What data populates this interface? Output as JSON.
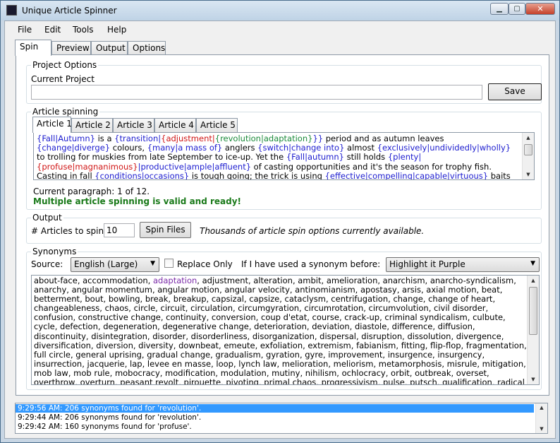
{
  "window": {
    "title": "Unique Article Spinner",
    "min_glyph": "▁",
    "max_glyph": "▢",
    "close_glyph": "✕"
  },
  "menu": [
    "File",
    "Edit",
    "Tools",
    "Help"
  ],
  "tabs": [
    "Spin",
    "Preview",
    "Output",
    "Options"
  ],
  "project": {
    "legend": "Project Options",
    "current_label": "Current Project",
    "current_value": "",
    "save_label": "Save"
  },
  "spinning": {
    "legend": "Article spinning",
    "article_tabs": [
      "Article 1",
      "Article 2",
      "Article 3",
      "Article 4",
      "Article 5"
    ],
    "text_lines": [
      [
        [
          "{Fall|Autumn}",
          "blue"
        ],
        [
          " is a ",
          ""
        ],
        [
          "{transition|",
          "blue"
        ],
        [
          "{adjustment|",
          "red"
        ],
        [
          "{revolution|adaptation}",
          "green"
        ],
        [
          "}}",
          "blue"
        ],
        [
          " period and as autumn leaves",
          ""
        ]
      ],
      [
        [
          "{change|diverge}",
          "blue"
        ],
        [
          " colours, ",
          ""
        ],
        [
          "{many|a mass of}",
          "blue"
        ],
        [
          " anglers ",
          ""
        ],
        [
          "{switch|change into}",
          "blue"
        ],
        [
          " almost ",
          ""
        ],
        [
          "{exclusively|undividedly|wholly}",
          "blue"
        ]
      ],
      [
        [
          "to trolling for muskies from late September to ice-up. Yet the ",
          ""
        ],
        [
          "{Fall|autumn}",
          "blue"
        ],
        [
          " still holds ",
          ""
        ],
        [
          "{plenty|",
          "blue"
        ]
      ],
      [
        [
          "{profuse|magnanimous}",
          "red"
        ],
        [
          "|productive|ample|affluent}",
          "blue"
        ],
        [
          " of casting opportunities and it's the season for trophy fish.",
          ""
        ]
      ],
      [
        [
          "Casting in fall ",
          ""
        ],
        [
          "{conditions|occasions}",
          "blue"
        ],
        [
          " is tough going; the trick is using ",
          ""
        ],
        [
          "{effective|compelling|capable|virtuous}",
          "blue"
        ],
        [
          " baits",
          ""
        ]
      ]
    ],
    "paragraph_status": "Current paragraph: 1 of 12.",
    "valid_message": "Multiple article spinning is valid and ready!"
  },
  "output": {
    "legend": "Output",
    "articles_label": "# Articles to spin:",
    "articles_value": "10",
    "spin_button": "Spin Files",
    "info": "Thousands of article spin options currently available."
  },
  "synonyms": {
    "legend": "Synonyms",
    "source_label": "Source:",
    "source_value": "English (Large)",
    "replace_only_label": "Replace Only",
    "replace_only_checked": false,
    "used_before_label": "If I have used a synonym before:",
    "used_before_value": "Highlight it Purple",
    "highlighted_word": "adaptation",
    "list_before": "about-face, accommodation, ",
    "list_after": ", adjustment, alteration, ambit, amelioration, anarchism, anarcho-syndicalism, anarchy, angular momentum, angular motion, angular velocity, antinomianism, apostasy, arsis, axial motion, beat, betterment, bout, bowling, break, breakup, capsizal, capsize, cataclysm, centrifugation, change, change of heart, changeableness, chaos, circle, circuit, circulation, circumgyration, circumrotation, circumvolution, civil disorder, confusion, constructive change, continuity, conversion, coup d'etat, course, crack-up, criminal syndicalism, culbute, cycle, defection, degeneration, degenerative change, deterioration, deviation, diastole, difference, diffusion, discontinuity, disintegration, disorder, disorderliness, disorganization, dispersal, disruption, dissolution, divergence, diversification, diversion, diversity, downbeat, emeute, exfoliation, extremism, fabianism, fitting, flip-flop, fragmentation, full circle, general uprising, gradual change, gradualism, gyration, gyre, improvement, insurgence, insurgency, insurrection, jacquerie, lap, levee en masse, loop, lynch law, melioration, meliorism, metamorphosis, misrule, mitigation, mob law, mob rule, mobocracy, modification, modulation, mutiny, nihilism, ochlocracy, orbit, outbreak, overset, overthrow, overturn, peasant revolt, pirouette, pivoting, primal chaos, progressivism, pulse, putsch, qualification, radical"
  },
  "log": [
    "9:29:56 AM: 206 synonyms found for 'revolution'.",
    "9:29:44 AM: 206 synonyms found for 'revolution'.",
    "9:29:42 AM: 160 synonyms found for 'profuse'."
  ],
  "colors": {
    "blue": "#1c1ccf",
    "red": "#d01515",
    "green": "#1a8a3a",
    "purple": "#7a2aa8",
    "valid": "#1a7a1a",
    "selection": "#3399ff"
  }
}
